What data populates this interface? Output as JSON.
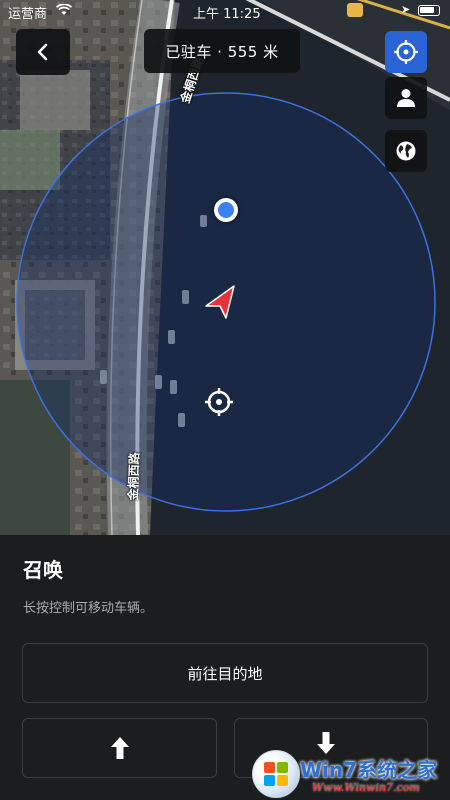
{
  "status_bar": {
    "carrier": "运营商",
    "time": "上午 11:25"
  },
  "map": {
    "title": "已驻车 · 555 米",
    "street_name_top": "金桐西路",
    "street_name_bottom": "金桐西路"
  },
  "icons": {
    "back": "chevron-left-icon",
    "recenter": "crosshair-icon",
    "person": "person-icon",
    "globe": "globe-icon",
    "vehicle": "navigation-arrow-icon",
    "target": "target-crosshair-icon",
    "user_location": "location-dot-icon",
    "forward": "arrow-up-icon",
    "reverse": "arrow-down-icon"
  },
  "colors": {
    "accent": "#2a63d6",
    "vehicle_arrow": "#e8323a",
    "location_dot": "#3b82f6",
    "panel_bg": "#1c1d1f"
  },
  "summon": {
    "heading": "召唤",
    "description": "长按控制可移动车辆。",
    "destination_button": "前往目的地"
  },
  "watermark": {
    "brand": "Win7系统之家",
    "url": "Www.Winwin7.com"
  }
}
